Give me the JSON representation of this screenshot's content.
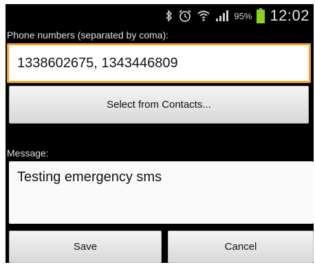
{
  "status_bar": {
    "icons": [
      "bluetooth-icon",
      "alarm-icon",
      "wifi-icon",
      "signal-icon",
      "battery-icon"
    ],
    "battery_percent": "95%",
    "battery_color": "#8bd21c",
    "time": "12:02"
  },
  "phone": {
    "label": "Phone numbers (separated by coma):",
    "value": "1338602675, 1343446809",
    "focus_color": "#f3a320"
  },
  "contacts_button": {
    "label": "Select from Contacts..."
  },
  "message": {
    "label": "Message:",
    "value": "Testing emergency sms"
  },
  "actions": {
    "save_label": "Save",
    "cancel_label": "Cancel"
  }
}
